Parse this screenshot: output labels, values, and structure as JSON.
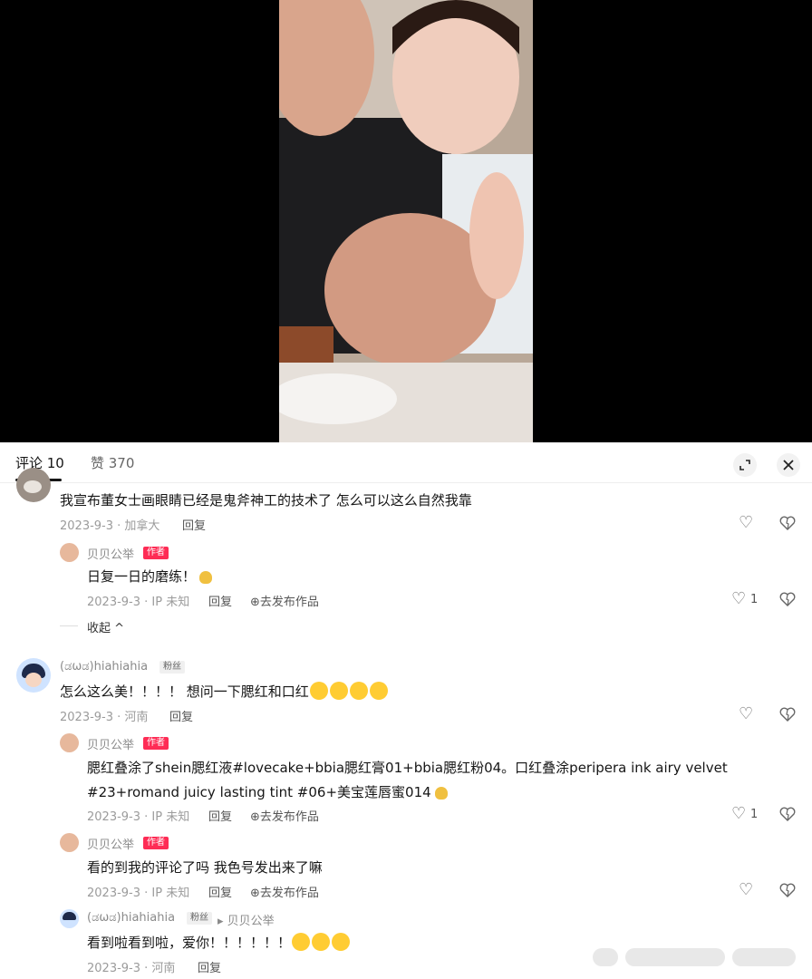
{
  "tabs": {
    "comments": "评论 10",
    "likes": "赞 370"
  },
  "comments": [
    {
      "text": "我宣布董女士画眼睛已经是鬼斧神工的技术了 怎么可以这么自然我靠",
      "date": "2023-9-3 · 加拿大",
      "reply_label": "回复",
      "replies": [
        {
          "name": "贝贝公举",
          "badge": "作者",
          "text": "日复一日的磨练！",
          "date": "2023-9-3 · IP 未知",
          "reply_label": "回复",
          "publish_label": "去发布作品",
          "likes": "1"
        }
      ],
      "collapse_label": "收起"
    },
    {
      "name": "(ಡωಡ)hiahiahia",
      "badge": "粉丝",
      "text": "怎么这么美！！！！ 想问一下腮红和口红",
      "date": "2023-9-3 · 河南",
      "reply_label": "回复",
      "replies": [
        {
          "name": "贝贝公举",
          "badge": "作者",
          "text_line1": "腮红叠涂了shein腮红液#lovecake+bbia腮红膏01+bbia腮红粉04。口红叠涂peripera ink airy velvet",
          "text_line2": "#23+romand juicy lasting tint #06+美宝莲唇蜜014",
          "date": "2023-9-3 · IP 未知",
          "reply_label": "回复",
          "publish_label": "去发布作品",
          "likes": "1"
        },
        {
          "name": "贝贝公举",
          "badge": "作者",
          "text": "看的到我的评论了吗 我色号发出来了嘛",
          "date": "2023-9-3 · IP 未知",
          "reply_label": "回复",
          "publish_label": "去发布作品"
        },
        {
          "name": "(ಡωಡ)hiahiahia",
          "badge": "粉丝",
          "reply_to": "▸ 贝贝公举",
          "text": "看到啦看到啦，爱你！！！！！！",
          "date": "2023-9-3 · 河南",
          "reply_label": "回复"
        }
      ]
    }
  ],
  "icons": [
    "expand-icon",
    "close-icon",
    "heart-icon",
    "dislike-icon",
    "publish-icon",
    "chevron-up-icon"
  ],
  "colors": {
    "author_badge": "#fe2c55",
    "video_bg": "#000000"
  }
}
